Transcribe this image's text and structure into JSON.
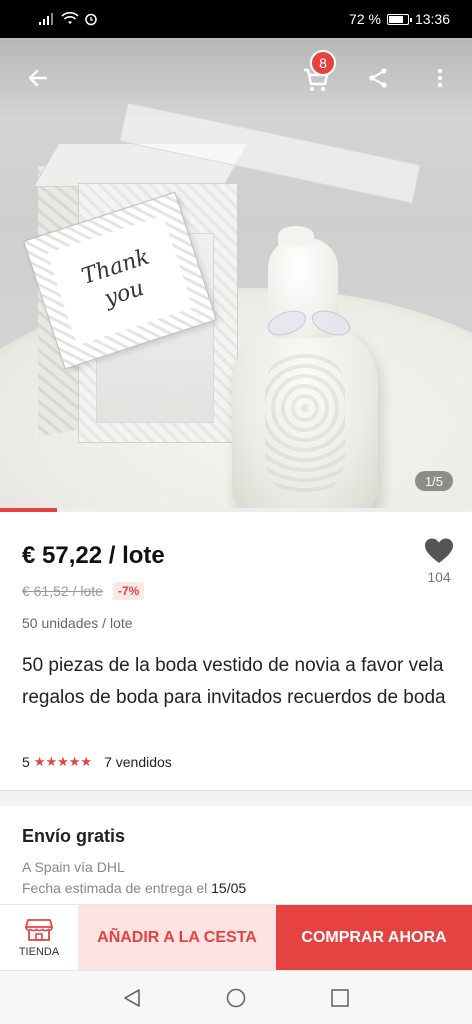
{
  "status_bar": {
    "battery": "72 %",
    "time": "13:36"
  },
  "header": {
    "cart_count": "8"
  },
  "gallery": {
    "pager": "1/5",
    "tag_line1": "Thank",
    "tag_line2": "you"
  },
  "product": {
    "price": "€ 57,22 / lote",
    "old_price": "€ 61,52 / lote",
    "discount": "-7%",
    "units": "50 unidades / lote",
    "wishlist_count": "104",
    "title": "50 piezas de la boda vestido de novia a favor vela regalos de boda para invitados recuerdos de boda",
    "rating": "5",
    "rating_stars": 5,
    "sold": "7 vendidos"
  },
  "shipping": {
    "title": "Envío gratis",
    "line1": "A Spain vía DHL",
    "line2_prefix": "Fecha estimada de entrega el ",
    "line2_date": "15/05"
  },
  "actions": {
    "store_label": "TIENDA",
    "add_to_cart": "AÑADIR A LA CESTA",
    "buy_now": "COMPRAR AHORA"
  },
  "colors": {
    "accent": "#e64340",
    "accent_light": "#fde3e3"
  },
  "icons": [
    "back-arrow-icon",
    "cart-icon",
    "share-icon",
    "more-vertical-icon",
    "heart-icon",
    "store-icon",
    "nav-back-icon",
    "nav-home-icon",
    "nav-recents-icon"
  ]
}
